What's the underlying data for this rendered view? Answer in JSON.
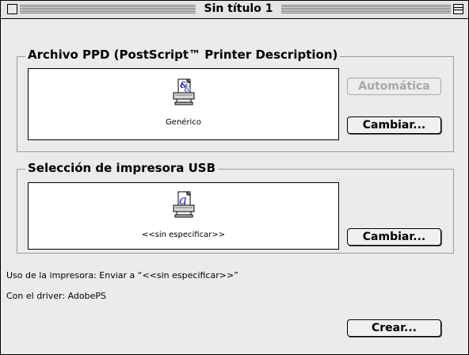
{
  "window": {
    "title": "Sin título 1"
  },
  "ppd_section": {
    "label": "Archivo PPD (PostScript™ Printer Description)",
    "selected_name": "Genérico",
    "auto_button": "Automática",
    "change_button": "Cambiar..."
  },
  "usb_section": {
    "label": "Selección de impresora USB",
    "selected_name": "<<sin especificar>>",
    "change_button": "Cambiar..."
  },
  "info": {
    "usage": "Uso de la impresora: Enviar a “<<sin especificar>>”",
    "driver": "Con el driver: AdobePS"
  },
  "create_button": "Crear...",
  "icons": {
    "title_close": "close-box-icon",
    "title_collapse": "collapse-box-icon",
    "ppd": "generic-ppd-printer-icon",
    "usb": "usb-printer-icon"
  }
}
